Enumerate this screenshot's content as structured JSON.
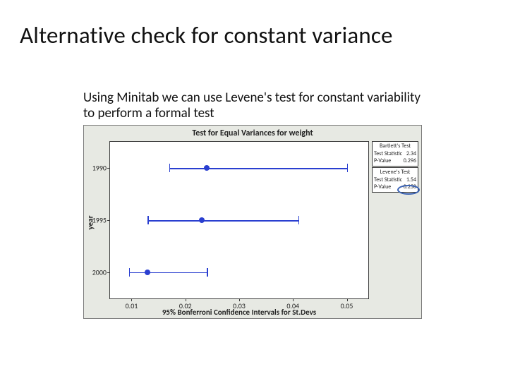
{
  "title": "Alternative check for constant variance",
  "subtitle": "Using Minitab we can use Levene's test for constant variability to perform a formal test",
  "chart_data": {
    "type": "scatter",
    "title": "Test for Equal Variances for weight",
    "ylabel": "year",
    "xlabel": "95% Bonferroni Confidence Intervals for St.Devs",
    "x_ticks": [
      0.01,
      0.02,
      0.03,
      0.04,
      0.05
    ],
    "xlim": [
      0.006,
      0.054
    ],
    "categories": [
      "1990",
      "1995",
      "2000"
    ],
    "series": [
      {
        "name": "CI",
        "intervals": [
          {
            "label": "1990",
            "low": 0.017,
            "mid": 0.024,
            "high": 0.05
          },
          {
            "label": "1995",
            "low": 0.013,
            "mid": 0.023,
            "high": 0.041
          },
          {
            "label": "2000",
            "low": 0.0095,
            "mid": 0.013,
            "high": 0.024
          }
        ]
      }
    ],
    "tests": {
      "bartlett": {
        "title": "Bartlett's Test",
        "test_statistic": "2.34",
        "p_value": "0.296"
      },
      "levene": {
        "title": "Levene's Test",
        "test_statistic": "1.54",
        "p_value": "0.250"
      }
    }
  },
  "labels": {
    "test_stat": "Test Statistic",
    "p_value": "P-Value"
  }
}
